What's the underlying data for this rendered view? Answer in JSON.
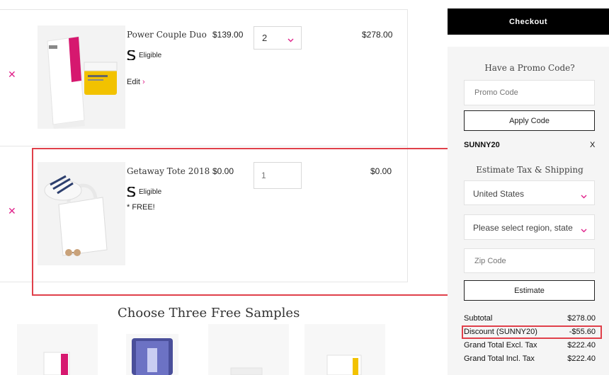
{
  "cart": {
    "items": [
      {
        "name": "Power Couple Duo",
        "price": "$139.00",
        "quantity": "2",
        "subtotal": "$278.00",
        "eligible_label": "Eligible",
        "edit_label": "Edit",
        "edit_icon": "chevron-right-icon",
        "remove_icon": "close-icon"
      },
      {
        "name": "Getaway Tote 2018",
        "price": "$0.00",
        "quantity_placeholder": "1",
        "subtotal": "$0.00",
        "eligible_label": "Eligible",
        "note": "* FREE!",
        "remove_icon": "close-icon"
      }
    ]
  },
  "samples": {
    "title": "Choose Three Free Samples"
  },
  "summary": {
    "checkout_label": "Checkout",
    "promo_heading": "Have a Promo Code?",
    "promo_placeholder": "Promo Code",
    "apply_label": "Apply Code",
    "applied_code": "SUNNY20",
    "applied_remove": "X",
    "estimate_heading": "Estimate Tax & Shipping",
    "country": "United States",
    "region_placeholder": "Please select region, state",
    "zip_placeholder": "Zip Code",
    "estimate_label": "Estimate",
    "totals": [
      {
        "label": "Subtotal",
        "amount": "$278.00"
      },
      {
        "label": "Discount (SUNNY20)",
        "amount": "-$55.60"
      },
      {
        "label": "Grand Total Excl. Tax",
        "amount": "$222.40"
      },
      {
        "label": "Grand Total Incl. Tax",
        "amount": "$222.40"
      }
    ]
  },
  "colors": {
    "accent": "#e0218a",
    "highlight": "#e0404a",
    "checkout_bg": "#000000",
    "panel_bg": "#f5f5f5"
  }
}
